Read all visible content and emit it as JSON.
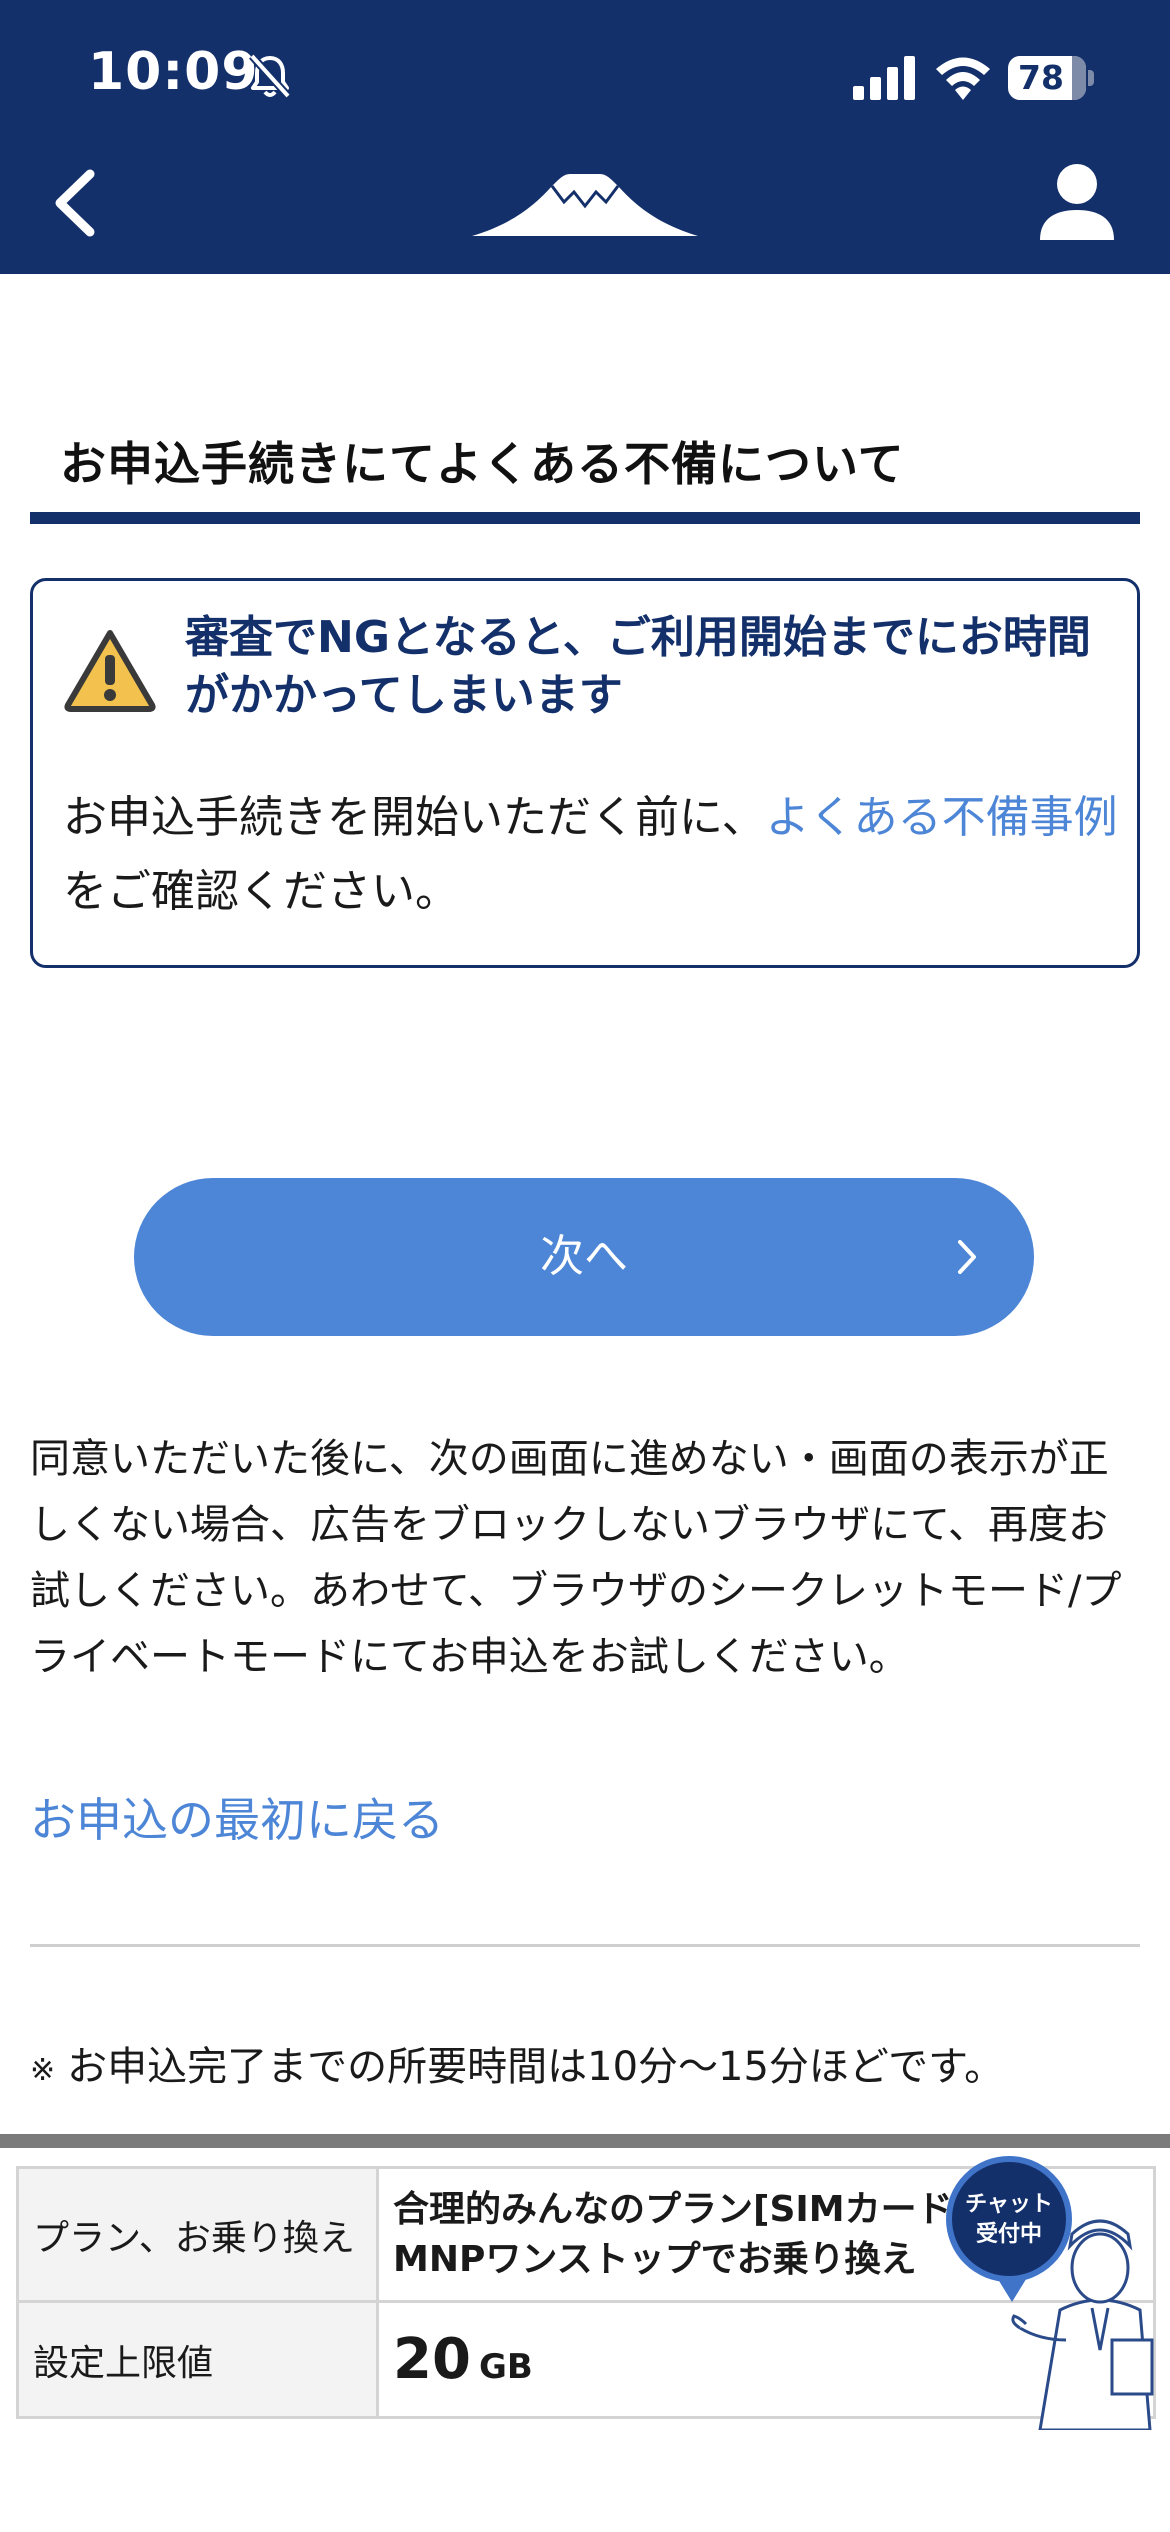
{
  "status_bar": {
    "time": "10:09",
    "battery_level": "78",
    "icons": [
      "bell-slash-icon",
      "cellular-signal-icon",
      "wifi-icon",
      "battery-icon"
    ]
  },
  "header": {
    "back_icon": "chevron-left-icon",
    "logo": "mountain-logo",
    "account_icon": "person-icon",
    "background_color": "#14306b"
  },
  "page": {
    "section_title": "お申込手続きにてよくある不備について"
  },
  "notice": {
    "icon": "warning-triangle-icon",
    "heading": "審査でNGとなると、ご利用開始までにお時間がかかってしまいます",
    "body_prefix": "お申込手続きを開始いただく前に、",
    "body_link": "よくある不備事例",
    "body_suffix": "をご確認ください。"
  },
  "next_button": {
    "label": "次へ",
    "icon": "chevron-right-icon",
    "color": "#4d86d6"
  },
  "info": {
    "text": "同意いただいた後に、次の画面に進めない・画面の表示が正しくない場合、広告をブロックしないブラウザにて、再度お試しください。あわせて、ブラウザのシークレットモード/プライベートモードにてお申込をお試しください。"
  },
  "restart_link": "お申込の最初に戻る",
  "note": {
    "mark": "※",
    "text": "お申込完了までの所要時間は10分〜15分ほどです。"
  },
  "summary_table": {
    "rows": [
      {
        "label": "プラン、お乗り換え",
        "value": "合理的みんなのプラン[SIMカード]・MNPワンストップでお乗り換え"
      },
      {
        "label": "設定上限値",
        "value_number": "20",
        "value_unit": "GB"
      }
    ]
  },
  "chat_widget": {
    "line1": "チャット",
    "line2": "受付中"
  },
  "colors": {
    "navy": "#14306b",
    "link_blue": "#4d86d6"
  }
}
